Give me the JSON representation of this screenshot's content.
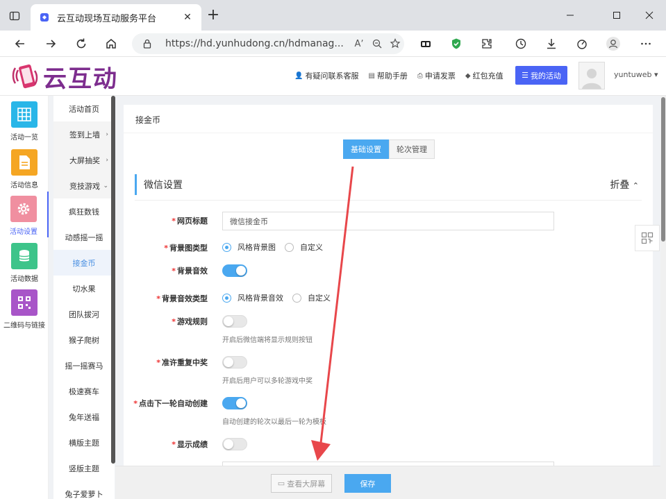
{
  "browser": {
    "tab_title": "云互动现场互动服务平台",
    "url": "https://hd.yunhudong.cn/hdmanag..."
  },
  "header": {
    "logo_text": "云互动",
    "links": [
      "有疑问联系客服",
      "帮助手册",
      "申请发票",
      "红包充值"
    ],
    "my_activity": "我的活动",
    "username": "yuntuweb"
  },
  "icon_nav": [
    {
      "label": "活动一览",
      "color": "#29b6e8"
    },
    {
      "label": "活动信息",
      "color": "#f5a623"
    },
    {
      "label": "活动设置",
      "color": "#f08fa0"
    },
    {
      "label": "活动数据",
      "color": "#3dc48a"
    },
    {
      "label": "二维码与链接",
      "color": "#a855c8"
    }
  ],
  "sub_nav": [
    {
      "label": "活动首页",
      "type": "item"
    },
    {
      "label": "签到上墙",
      "type": "group",
      "arrow": "›"
    },
    {
      "label": "大屏抽奖",
      "type": "group",
      "arrow": "›"
    },
    {
      "label": "竞技游戏",
      "type": "group",
      "arrow": "⌄"
    },
    {
      "label": "疯狂数钱",
      "type": "item"
    },
    {
      "label": "动感摇一摇",
      "type": "item"
    },
    {
      "label": "接金币",
      "type": "active"
    },
    {
      "label": "切水果",
      "type": "item"
    },
    {
      "label": "团队拔河",
      "type": "item"
    },
    {
      "label": "猴子爬树",
      "type": "item"
    },
    {
      "label": "摇一摇赛马",
      "type": "item"
    },
    {
      "label": "极速赛车",
      "type": "item"
    },
    {
      "label": "兔年送福",
      "type": "item"
    },
    {
      "label": "横版主题",
      "type": "item"
    },
    {
      "label": "竖版主题",
      "type": "item"
    },
    {
      "label": "兔子爱萝卜",
      "type": "item"
    }
  ],
  "main": {
    "breadcrumb": "接金币",
    "tabs": [
      "基础设置",
      "轮次管理"
    ],
    "section_title": "微信设置",
    "fold_label": "折叠",
    "form": {
      "page_title_label": "网页标题",
      "page_title_value": "微信接金币",
      "bg_type_label": "背景图类型",
      "bg_type_options": [
        "风格背景图",
        "自定义"
      ],
      "bg_sound_label": "背景音效",
      "bg_sound_type_label": "背景音效类型",
      "bg_sound_type_options": [
        "风格背景音效",
        "自定义"
      ],
      "rules_label": "游戏规则",
      "rules_hint": "开启后微信端将显示规则按钮",
      "repeat_label": "准许重复中奖",
      "repeat_hint": "开启后用户可以多轮游戏中奖",
      "auto_next_label": "点击下一轮自动创建",
      "auto_next_hint": "自动创建的轮次以最后一轮为模板",
      "show_score_label": "显示成绩",
      "required_mark": "*"
    }
  },
  "bottom": {
    "preview": "查看大屏幕",
    "save": "保存"
  },
  "colors": {
    "accent": "#4aa8f0",
    "primary_button": "#4a64f5",
    "arrow": "#e8474b"
  }
}
